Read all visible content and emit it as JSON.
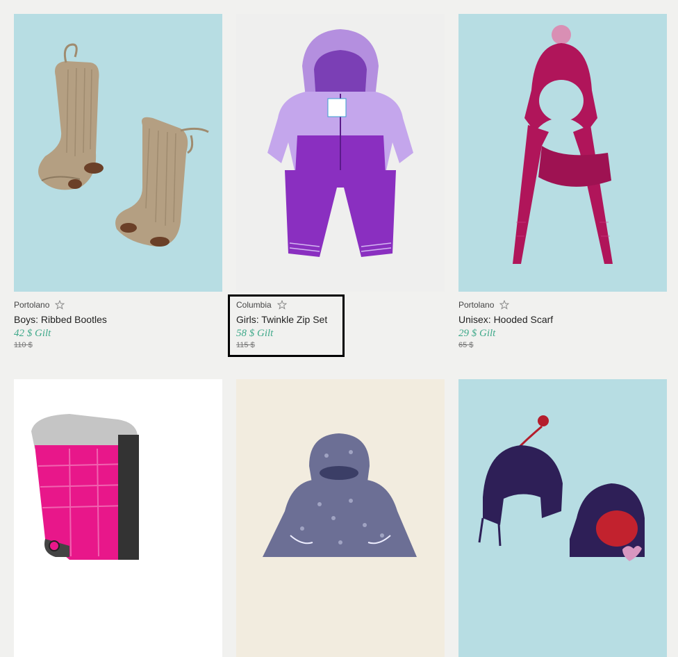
{
  "products": [
    {
      "brand": "Portolano",
      "name": "Boys: Ribbed Bootles",
      "price": "42 $ Gilt",
      "original_price": "110 $",
      "image": "ribbed-booties"
    },
    {
      "brand": "Columbia",
      "name": "Girls: Twinkle Zip Set",
      "price": "58 $ Gilt",
      "original_price": "115 $",
      "image": "purple-snowsuit"
    },
    {
      "brand": "Portolano",
      "name": "Unisex: Hooded Scarf",
      "price": "29 $ Gilt",
      "original_price": "65 $",
      "image": "hooded-scarf"
    },
    {
      "image": "pink-snow-boot"
    },
    {
      "image": "printed-snowsuit"
    },
    {
      "image": "trapper-hats"
    }
  ],
  "colors": {
    "page_bg": "#f1f1ef",
    "sale_price": "#3fa98a",
    "image_bg_blue": "#b7dde3"
  }
}
